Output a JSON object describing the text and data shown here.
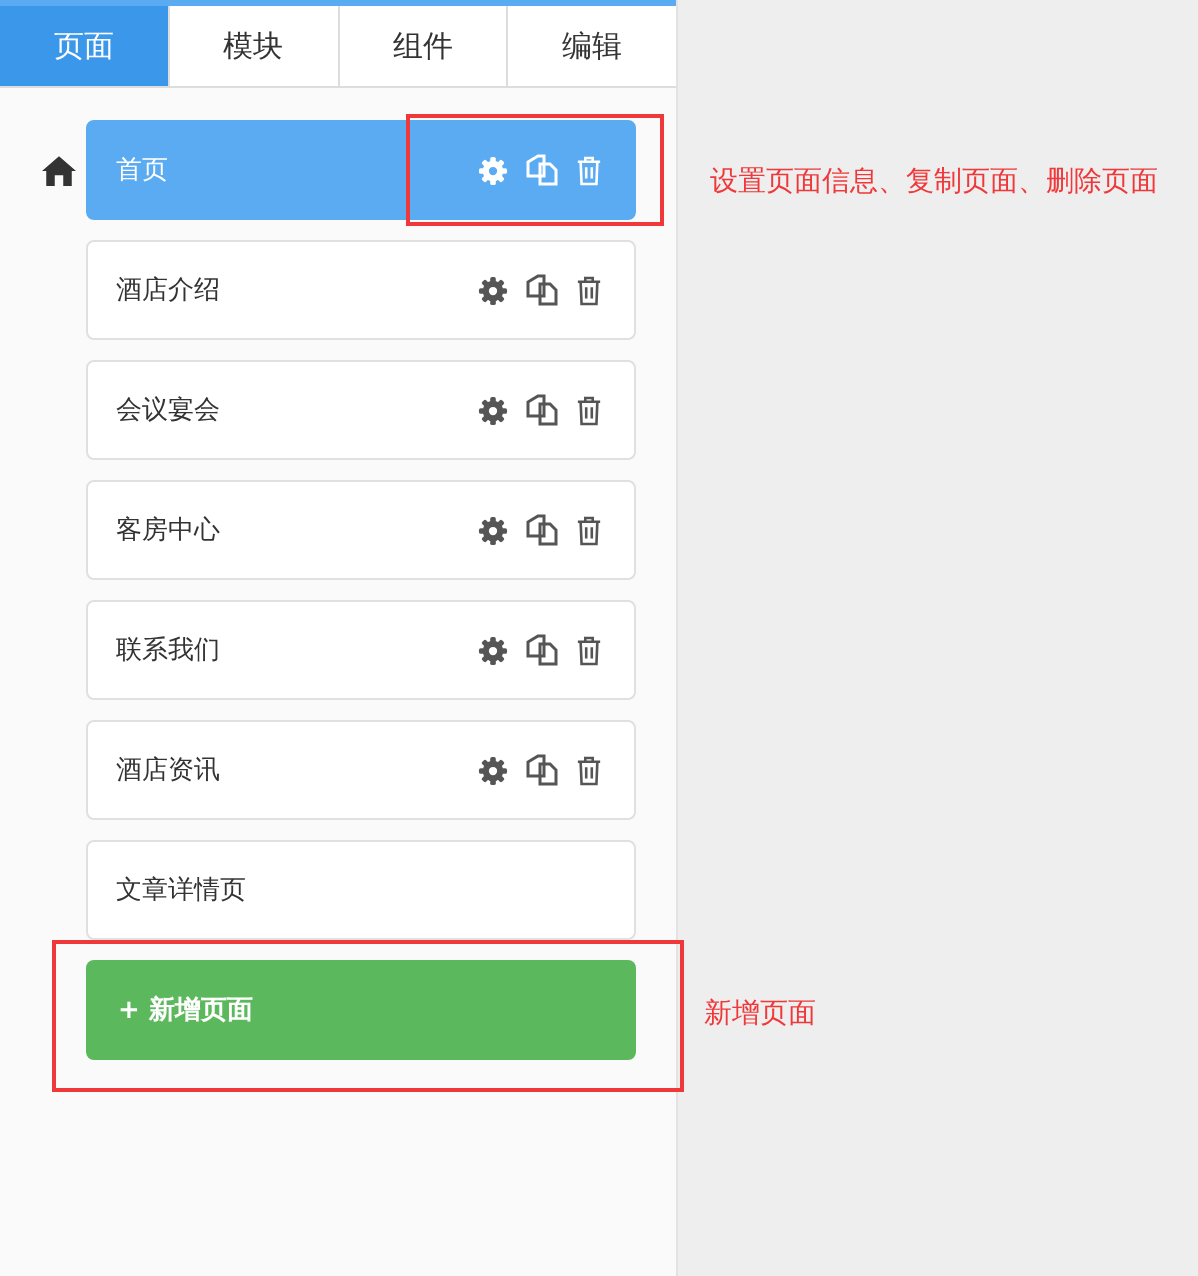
{
  "tabs": [
    {
      "label": "页面",
      "selected": true
    },
    {
      "label": "模块",
      "selected": false
    },
    {
      "label": "组件",
      "selected": false
    },
    {
      "label": "编辑",
      "selected": false
    }
  ],
  "pages": [
    {
      "name": "首页",
      "selected": true,
      "actions": true
    },
    {
      "name": "酒店介绍",
      "selected": false,
      "actions": true
    },
    {
      "name": "会议宴会",
      "selected": false,
      "actions": true
    },
    {
      "name": "客房中心",
      "selected": false,
      "actions": true
    },
    {
      "name": "联系我们",
      "selected": false,
      "actions": true
    },
    {
      "name": "酒店资讯",
      "selected": false,
      "actions": true
    },
    {
      "name": "文章详情页",
      "selected": false,
      "actions": false
    }
  ],
  "add_button": "+ 新增页面",
  "annotations": [
    "设置页面信息、复制页面、删除页面",
    "新增页面"
  ]
}
